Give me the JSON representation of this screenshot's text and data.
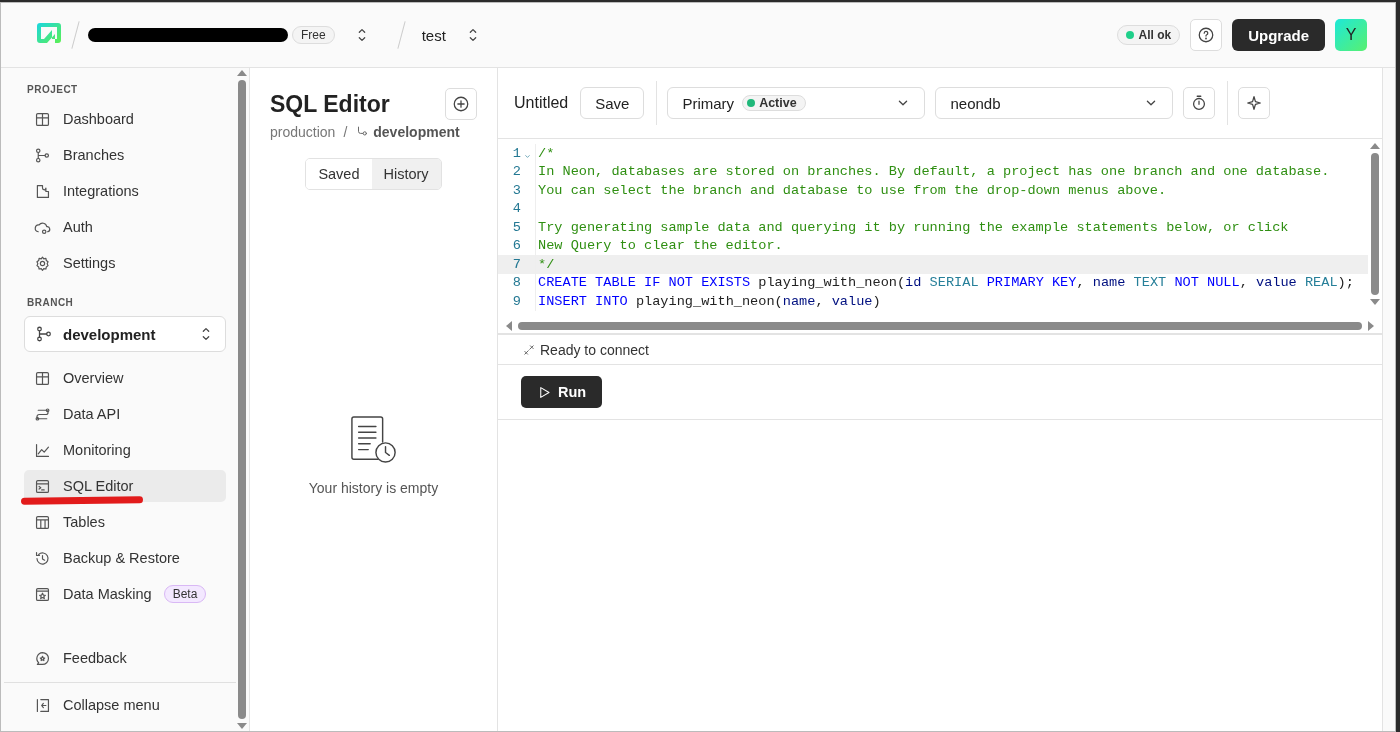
{
  "header": {
    "plan_badge": "Free",
    "project": "test",
    "status": {
      "label": "All ok",
      "color": "#1fcf8a"
    },
    "upgrade": "Upgrade",
    "avatar": "Y"
  },
  "sidebar": {
    "sections": [
      {
        "title": "PROJECT",
        "items": [
          {
            "label": "Dashboard",
            "selected": false
          },
          {
            "label": "Branches",
            "selected": false
          },
          {
            "label": "Integrations",
            "selected": false
          },
          {
            "label": "Auth",
            "selected": false
          },
          {
            "label": "Settings",
            "selected": false
          }
        ]
      },
      {
        "title": "BRANCH",
        "branch": "development",
        "items": [
          {
            "label": "Overview",
            "selected": false
          },
          {
            "label": "Data API",
            "selected": false
          },
          {
            "label": "Monitoring",
            "selected": false
          },
          {
            "label": "SQL Editor",
            "selected": true
          },
          {
            "label": "Tables",
            "selected": false
          },
          {
            "label": "Backup & Restore",
            "selected": false
          },
          {
            "label": "Data Masking",
            "selected": false,
            "badge": "Beta"
          }
        ]
      }
    ],
    "feedback": "Feedback",
    "collapse": "Collapse menu"
  },
  "panel": {
    "title": "SQL Editor",
    "breadcrumb": [
      "production",
      "/",
      "development"
    ],
    "tabs": [
      {
        "label": "Saved",
        "selected": false
      },
      {
        "label": "History",
        "selected": true
      }
    ],
    "empty_message": "Your history is empty"
  },
  "editor": {
    "query_name": "Untitled",
    "save": "Save",
    "branch": {
      "label": "Primary",
      "badge": "Active",
      "color": "#1fb87a"
    },
    "database": "neondb",
    "lines": [
      {
        "number": "1",
        "active": false,
        "tokens": [
          {
            "kind": "comment",
            "text": "/*"
          }
        ]
      },
      {
        "number": "2",
        "active": false,
        "tokens": [
          {
            "kind": "comment",
            "text": "In Neon, databases are stored on branches. By default, a project has one branch and one database."
          }
        ]
      },
      {
        "number": "3",
        "active": false,
        "tokens": [
          {
            "kind": "comment",
            "text": "You can select the branch and database to use from the drop-down menus above."
          }
        ]
      },
      {
        "number": "4",
        "active": false
      },
      {
        "number": "5",
        "active": false,
        "tokens": [
          {
            "kind": "comment",
            "text": "Try generating sample data and querying it by running the example statements below, or click"
          }
        ]
      },
      {
        "number": "6",
        "active": false,
        "tokens": [
          {
            "kind": "comment",
            "text": "New Query to clear the editor."
          }
        ]
      },
      {
        "number": "7",
        "active": true,
        "tokens": [
          {
            "kind": "comment",
            "text": "*/"
          }
        ]
      },
      {
        "number": "8",
        "active": false,
        "tokens": [
          {
            "kind": "keyword",
            "text": "CREATE TABLE IF NOT EXISTS"
          },
          {
            "kind": "plain",
            "text": " playing_with_neon("
          },
          {
            "kind": "variable",
            "text": "id"
          },
          {
            "kind": "type",
            "text": " SERIAL"
          },
          {
            "kind": "keyword",
            "text": " PRIMARY KEY"
          },
          {
            "kind": "plain",
            "text": ","
          },
          {
            "kind": "variable",
            "text": " name"
          },
          {
            "kind": "type",
            "text": " TEXT"
          },
          {
            "kind": "keyword",
            "text": " NOT NULL"
          },
          {
            "kind": "plain",
            "text": ","
          },
          {
            "kind": "variable",
            "text": " value"
          },
          {
            "kind": "type",
            "text": " REAL"
          },
          {
            "kind": "plain",
            "text": ");"
          }
        ]
      },
      {
        "number": "9",
        "active": false,
        "tokens": [
          {
            "kind": "keyword",
            "text": "INSERT INTO"
          },
          {
            "kind": "plain",
            "text": " playing_with_neon("
          },
          {
            "kind": "variable",
            "text": "name"
          },
          {
            "kind": "plain",
            "text": ","
          },
          {
            "kind": "variable",
            "text": " value"
          },
          {
            "kind": "plain",
            "text": ")"
          }
        ]
      }
    ],
    "status": "Ready to connect",
    "run": "Run"
  }
}
